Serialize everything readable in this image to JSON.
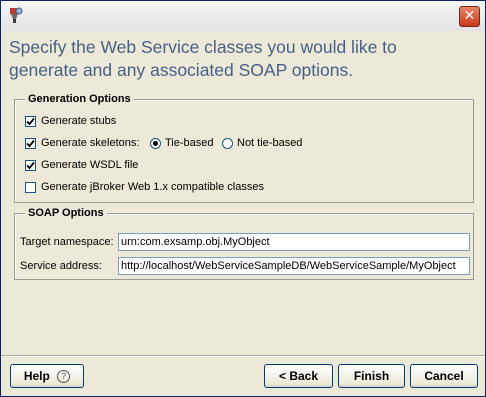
{
  "header": {
    "text": "Specify the Web Service classes you would like to generate and any associated SOAP options."
  },
  "generation": {
    "legend": "Generation Options",
    "stubs": {
      "label": "Generate stubs",
      "checked": true
    },
    "skeletons": {
      "label": "Generate skeletons:",
      "checked": true
    },
    "tie_based": {
      "label": "Tie-based",
      "selected": true
    },
    "not_tie_based": {
      "label": "Not tie-based",
      "selected": false
    },
    "wsdl": {
      "label": "Generate WSDL file",
      "checked": true
    },
    "jbroker": {
      "label": "Generate jBroker Web 1.x compatible classes",
      "checked": false
    }
  },
  "soap": {
    "legend": "SOAP Options",
    "namespace_label": "Target namespace:",
    "namespace_value": "urn:com.exsamp.obj.MyObject",
    "address_label": "Service address:",
    "address_value": "http://localhost/WebServiceSampleDB/WebServiceSample/MyObject"
  },
  "footer": {
    "help_label": "Help",
    "help_icon": "?",
    "back_label": "< Back",
    "finish_label": "Finish",
    "cancel_label": "Cancel"
  },
  "icons": {
    "close": "close-icon",
    "app": "app-icon",
    "help": "help-icon"
  }
}
